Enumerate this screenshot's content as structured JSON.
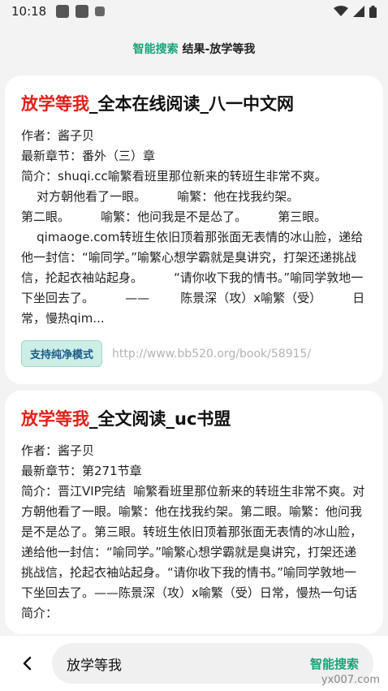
{
  "status": {
    "time": "10:18"
  },
  "header": {
    "accent": "智能搜索",
    "sep": " ",
    "title": "结果-放学等我"
  },
  "cards": [
    {
      "title_highlight": "放学等我",
      "title_rest": "_全本在线阅读_八一中文网",
      "author": "作者：酱子贝",
      "latest": "最新章节：番外（三）章",
      "intro": "简介：shuqi.cc喻繁看班里那位新来的转班生非常不爽。\n    对方朝他看了一眼。        喻繁：他在找我约架。\n第二眼。        喻繁：他问我是不是怂了。        第三眼。\n    qimaoge.com转班生依旧顶着那张面无表情的冰山脸，递给他一封信：“喻同学。”喻繁心想学霸就是臭讲究，打架还递挑战信，抡起衣袖站起身。        “请你收下我的情书。”喻同学敦地一下坐回去了。        ——        陈景深（攻）x喻繁（受）        日常，慢热qim...",
      "pure_label": "支持纯净模式",
      "url": "http://www.bb520.org/book/58915/"
    },
    {
      "title_highlight": "放学等我",
      "title_rest": "_全文阅读_uc书盟",
      "author": "作者：酱子贝",
      "latest": "最新章节：第271节章",
      "intro": "简介：晋江VIP完结  喻繁看班里那位新来的转班生非常不爽。对方朝他看了一眼。喻繁：他在找我约架。第二眼。喻繁：他问我是不是怂了。第三眼。转班生依旧顶着那张面无表情的冰山脸，递给他一封信：“喻同学。”喻繁心想学霸就是臭讲究，打架还递挑战信，抡起衣袖站起身。“请你收下我的情书。”喻同学敦地一下坐回去了。——陈景深（攻）x喻繁（受）日常，慢热一句话简介："
    }
  ],
  "search": {
    "query": "放学等我",
    "action": "智能搜索"
  },
  "watermark": "yx007.com"
}
